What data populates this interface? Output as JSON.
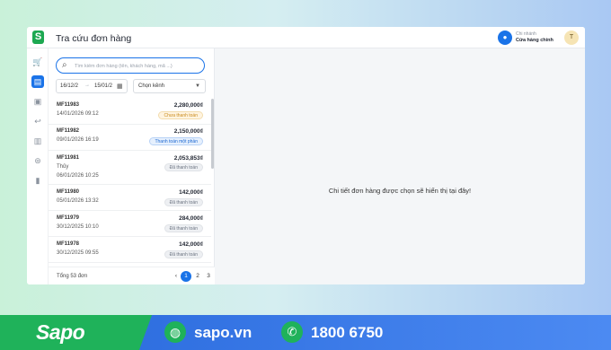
{
  "app": {
    "logo_letter": "S",
    "title": "Tra cứu đơn hàng"
  },
  "branch": {
    "label": "Chi nhánh",
    "name": "Cửa hàng chính"
  },
  "user": {
    "avatar_initial": "T"
  },
  "search": {
    "placeholder": "Tìm kiếm đơn hàng (tên, khách hàng, mã ...)"
  },
  "filters": {
    "date_from": "16/12/2",
    "date_to": "15/01/2",
    "channel": "Chọn kênh"
  },
  "orders": [
    {
      "code": "MF11983",
      "customer": "",
      "date": "14/01/2026 09:12",
      "amount": "2,280,000₫",
      "status": "Chưa thanh toán",
      "status_type": "unpaid"
    },
    {
      "code": "MF11982",
      "customer": "",
      "date": "09/01/2026 16:19",
      "amount": "2,150,000₫",
      "status": "Thanh toán một phần",
      "status_type": "partial"
    },
    {
      "code": "MF11981",
      "customer": "Thủy",
      "date": "06/01/2026 10:25",
      "amount": "2,053,853₫",
      "status": "Đã thanh toán",
      "status_type": "paid"
    },
    {
      "code": "MF11980",
      "customer": "",
      "date": "05/01/2026 13:32",
      "amount": "142,000₫",
      "status": "Đã thanh toán",
      "status_type": "paid"
    },
    {
      "code": "MF11979",
      "customer": "",
      "date": "30/12/2025 10:10",
      "amount": "284,000₫",
      "status": "Đã thanh toán",
      "status_type": "paid"
    },
    {
      "code": "MF11978",
      "customer": "",
      "date": "30/12/2025 09:55",
      "amount": "142,000₫",
      "status": "Đã thanh toán",
      "status_type": "paid"
    }
  ],
  "footer": {
    "total": "Tổng 53 đơn",
    "pages": [
      "1",
      "2",
      "3"
    ],
    "current_page": "1",
    "prev": "‹",
    "next": "›"
  },
  "detail": {
    "placeholder": "Chi tiết đơn hàng được chọn sẽ hiển thị tại đây!"
  },
  "banner": {
    "brand": "Sapo",
    "website": "sapo.vn",
    "hotline": "1800 6750"
  },
  "colors": {
    "accent": "#1a73e8",
    "brand_green": "#1fb25a"
  }
}
